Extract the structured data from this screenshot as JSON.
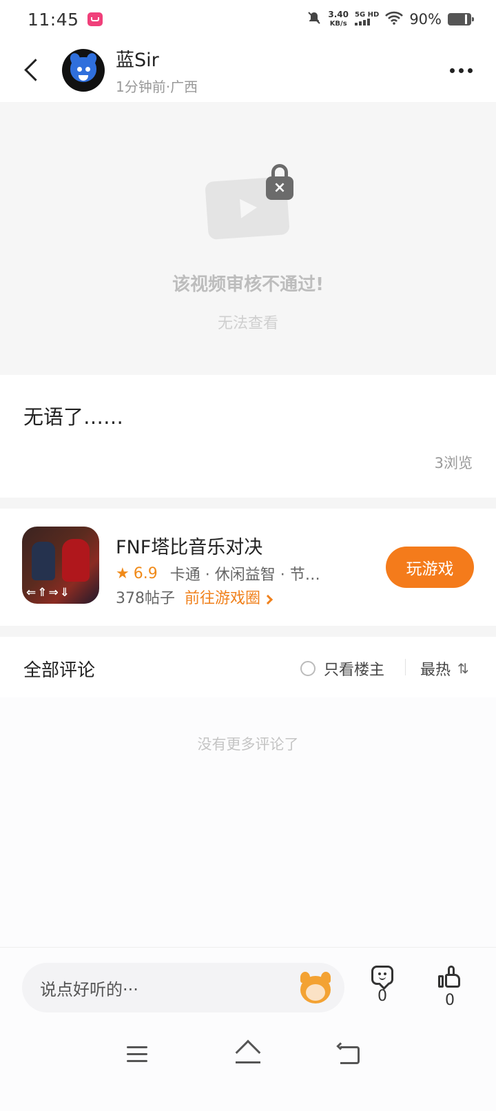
{
  "status_bar": {
    "time": "11:45",
    "net_speed_value": "3.40",
    "net_speed_unit": "KB/s",
    "network": "5G HD",
    "battery": "90%"
  },
  "header": {
    "username": "蓝Sir",
    "meta": "1分钟前·广西"
  },
  "video": {
    "blocked_title": "该视频审核不通过!",
    "blocked_sub": "无法查看"
  },
  "post": {
    "text": "无语了……",
    "views": "3浏览"
  },
  "game": {
    "name": "FNF塔比音乐对决",
    "rating": "6.9",
    "tags": "卡通 · 休闲益智 · 节…",
    "posts": "378帖子",
    "goto_label": "前往游戏圈",
    "play_label": "玩游戏",
    "icon_arrows": "⇐⇑⇒⇓"
  },
  "comments": {
    "title": "全部评论",
    "only_owner": "只看楼主",
    "sort_label": "最热",
    "empty_text": "没有更多评论了"
  },
  "bottom_bar": {
    "input_placeholder": "说点好听的···",
    "comment_count": "0",
    "like_count": "0"
  },
  "colors": {
    "accent": "#f47b1b",
    "rating": "#f08a19"
  }
}
